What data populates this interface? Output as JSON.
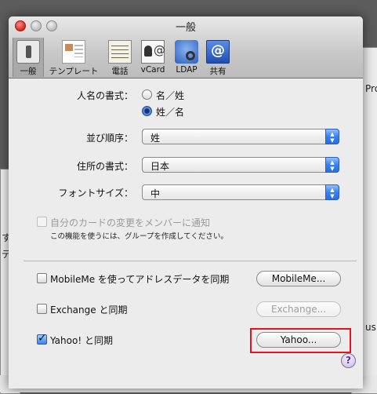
{
  "window": {
    "title": "一般"
  },
  "toolbar": {
    "items": [
      {
        "label": "一般",
        "icon": "general-switch-icon",
        "selected": true
      },
      {
        "label": "テンプレート",
        "icon": "template-icon",
        "selected": false
      },
      {
        "label": "電話",
        "icon": "phone-icon",
        "selected": false
      },
      {
        "label": "vCard",
        "icon": "vcard-icon",
        "selected": false
      },
      {
        "label": "LDAP",
        "icon": "ldap-icon",
        "selected": false
      },
      {
        "label": "共有",
        "icon": "share-icon",
        "selected": false
      }
    ]
  },
  "name_format": {
    "label": "人名の書式：",
    "options": [
      "名／姓",
      "姓／名"
    ],
    "selected": "姓／名"
  },
  "sort_order": {
    "label": "並び順序：",
    "value": "姓"
  },
  "address_format": {
    "label": "住所の書式：",
    "value": "日本"
  },
  "font_size": {
    "label": "フォントサイズ：",
    "value": "中"
  },
  "my_card": {
    "label": "自分のカードの変更をメンバーに通知",
    "checked": false,
    "enabled": false,
    "note": "この機能を使うには、グループを作成してください。"
  },
  "sync": {
    "mobileme": {
      "label": "MobileMe を使ってアドレスデータを同期",
      "checked": false,
      "button": "MobileMe..."
    },
    "exchange": {
      "label": "Exchange と同期",
      "checked": false,
      "button": "Exchange...",
      "button_enabled": false
    },
    "yahoo": {
      "label": "Yahoo! と同期",
      "checked": true,
      "button": "Yahoo..."
    }
  },
  "help_button": "?",
  "highlight_color": "#e2161a",
  "accent_color": "#3a7ff0",
  "background_fragments": {
    "right_text": "Pro",
    "left_text_1": "す",
    "left_text_2": "デ",
    "right_text_2": "us"
  }
}
